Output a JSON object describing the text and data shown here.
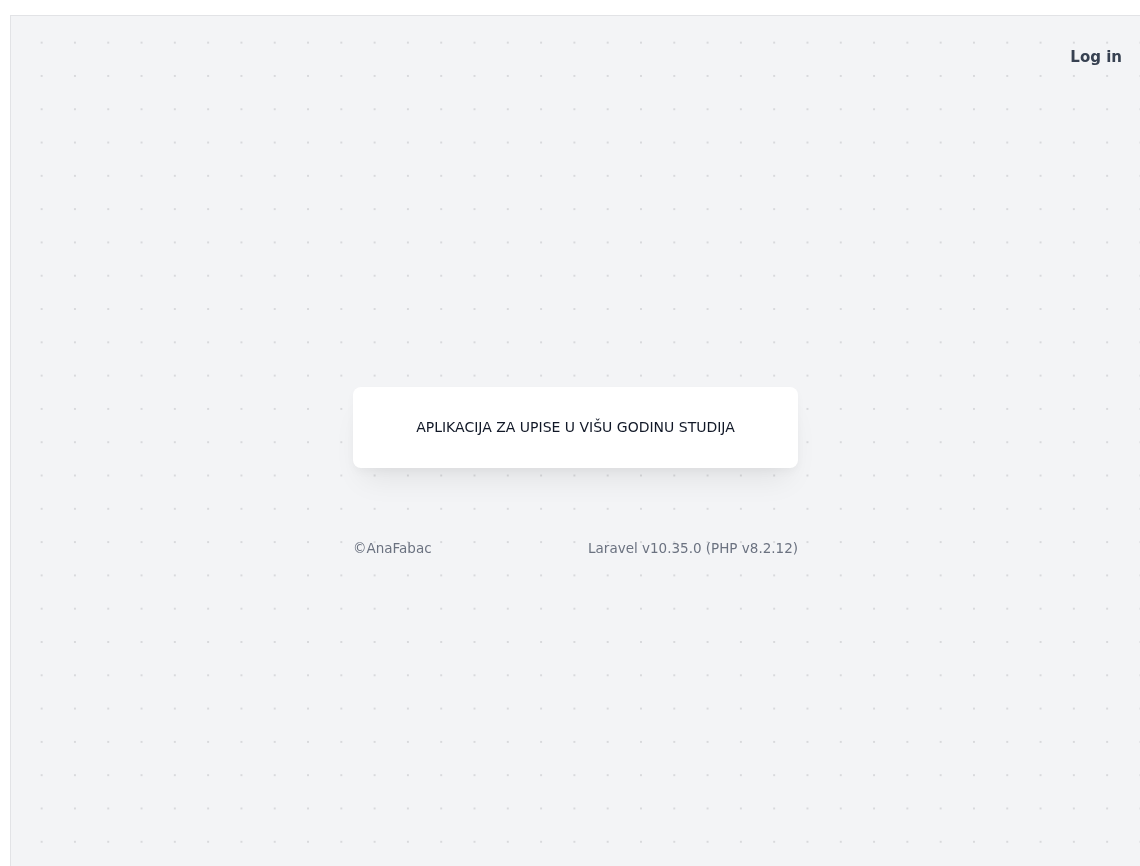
{
  "nav": {
    "login_link": "Log in"
  },
  "card": {
    "title": "APLIKACIJA ZA UPISE U VIŠU GODINU STUDIJA"
  },
  "footer": {
    "author": "©AnaFabac",
    "version": "Laravel v10.35.0 (PHP v8.2.12)"
  }
}
